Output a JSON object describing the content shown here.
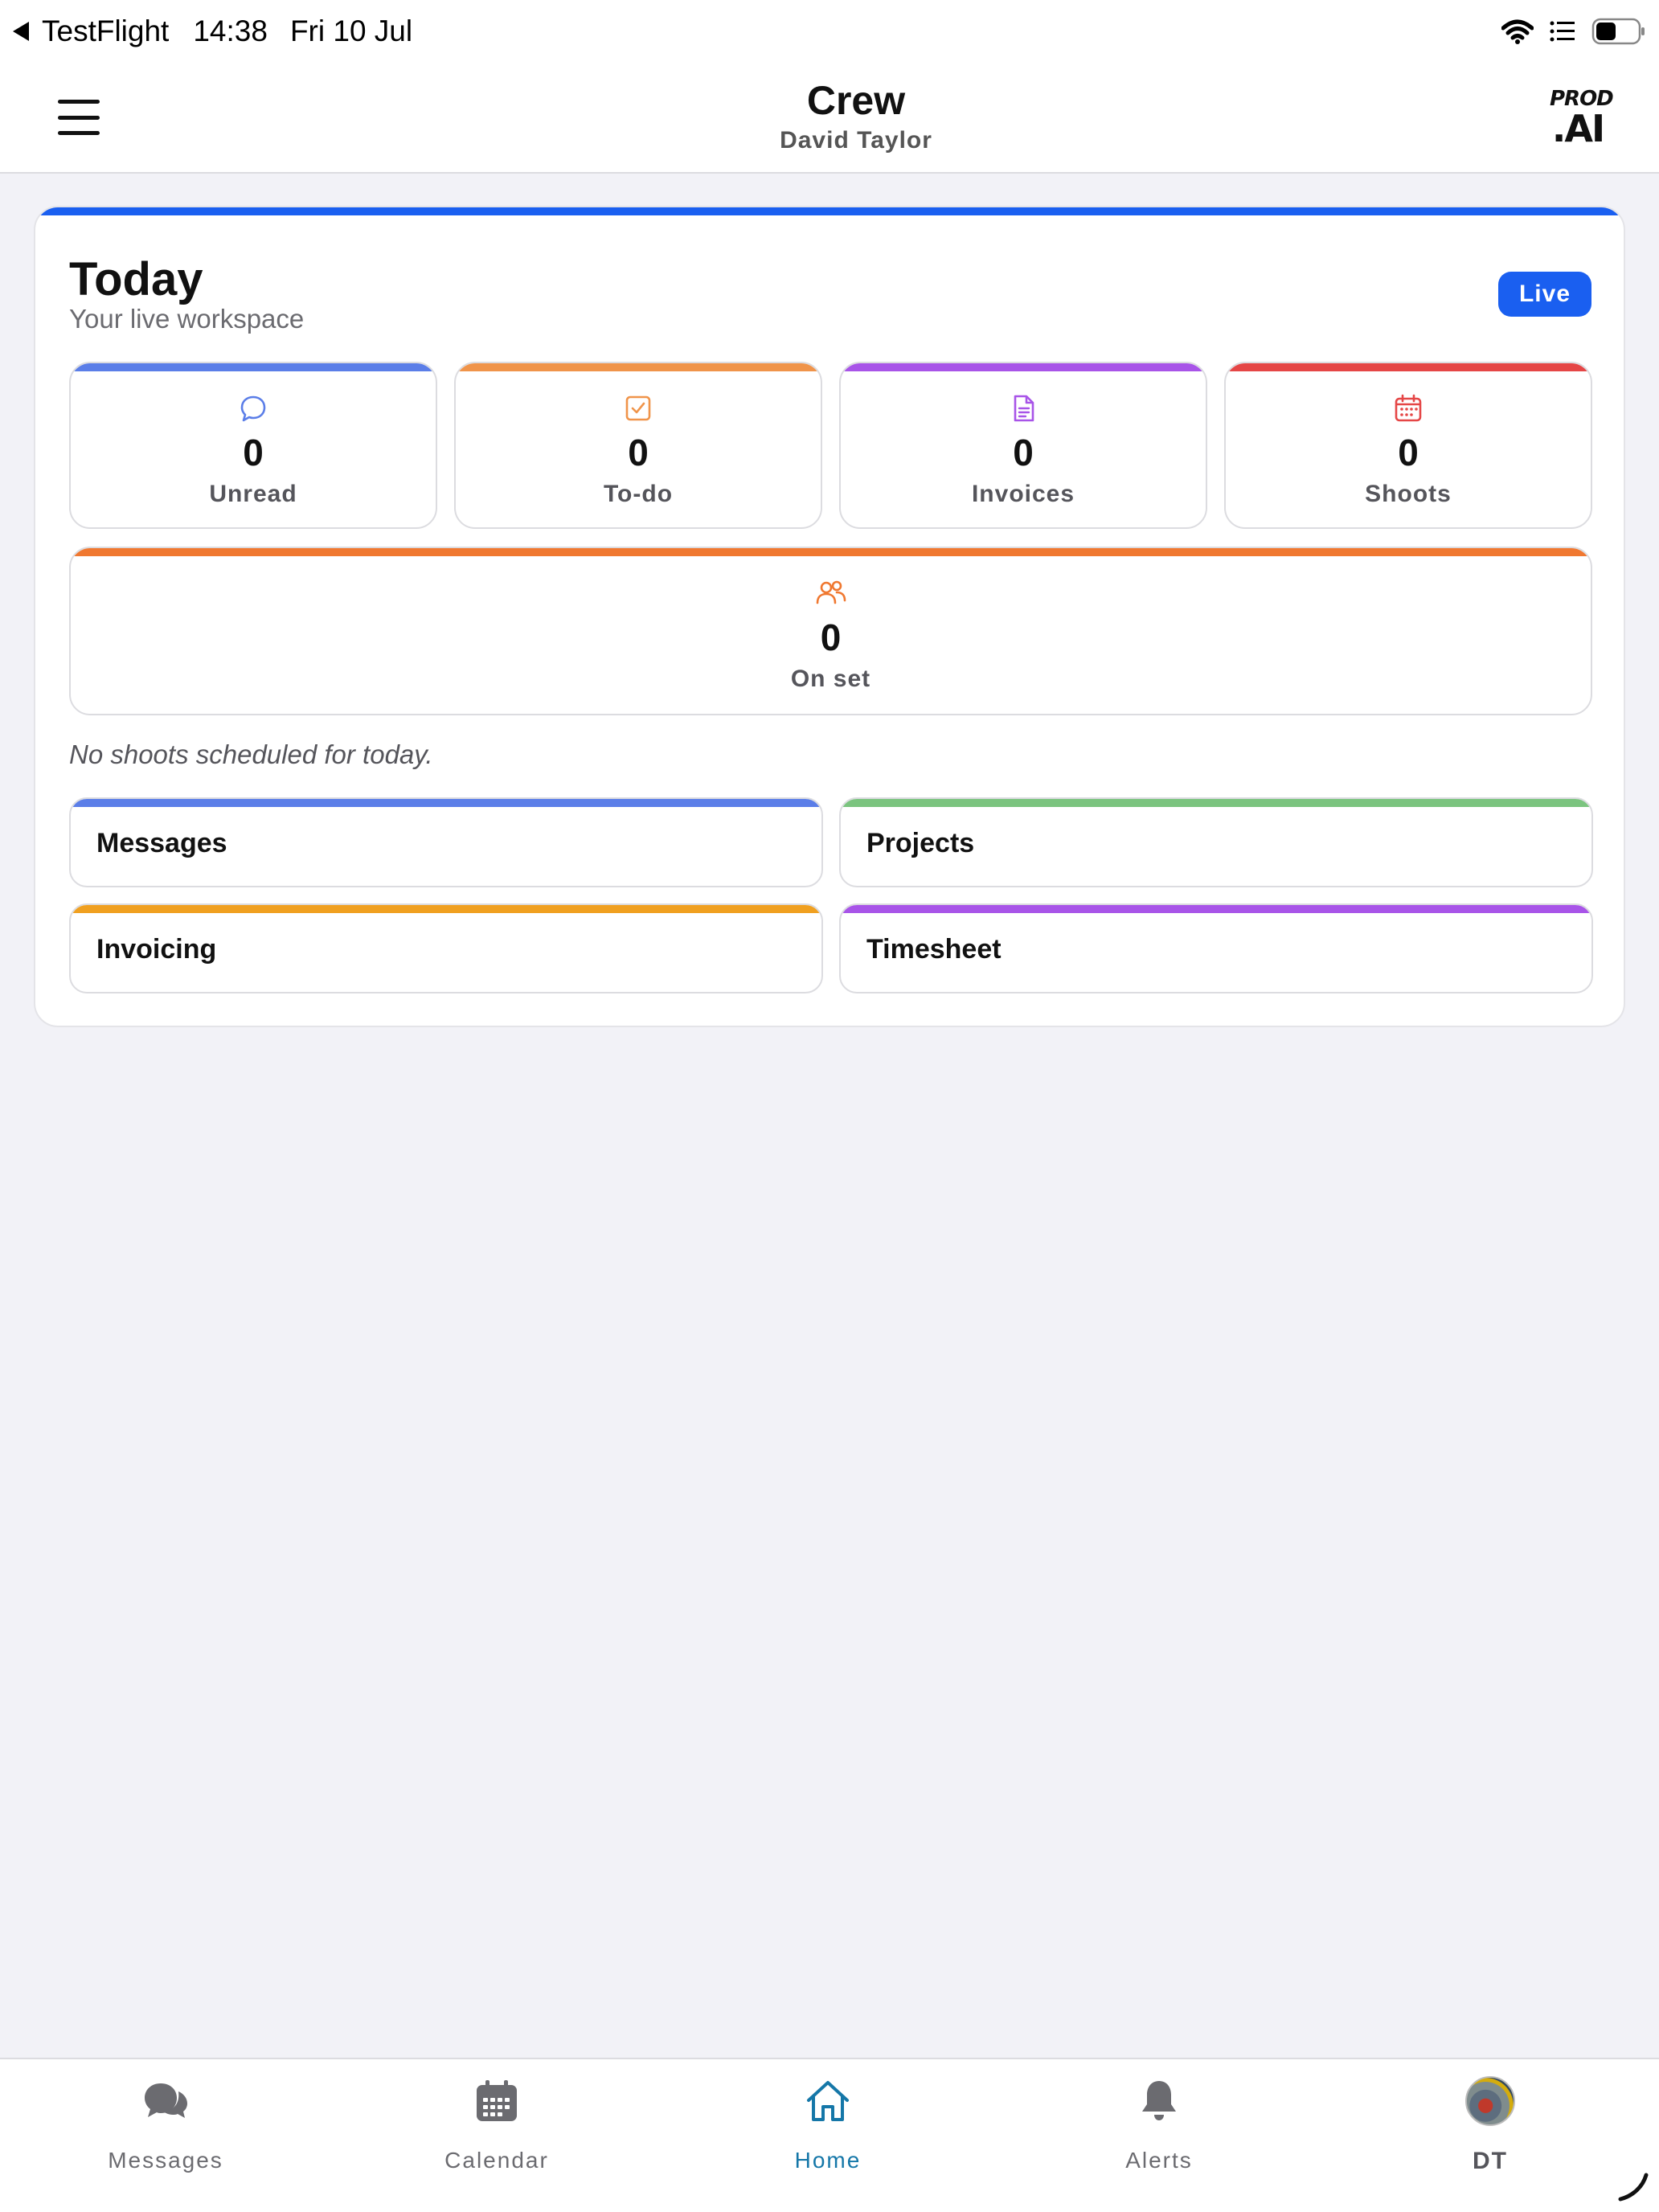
{
  "status_bar": {
    "back_app": "TestFlight",
    "time": "14:38",
    "date": "Fri 10 Jul"
  },
  "header": {
    "title": "Crew",
    "subtitle": "David Taylor",
    "logo_top": "PROD",
    "logo_bottom": ".AI"
  },
  "today": {
    "title": "Today",
    "subtitle": "Your live workspace",
    "badge": "Live",
    "accent_color": "#1a5ff0",
    "stats": [
      {
        "label": "Unread",
        "value": "0",
        "icon": "chat-bubble-icon",
        "color": "#5b7ee8"
      },
      {
        "label": "To-do",
        "value": "0",
        "icon": "checkbox-icon",
        "color": "#f0944a"
      },
      {
        "label": "Invoices",
        "value": "0",
        "icon": "document-icon",
        "color": "#a854e8"
      },
      {
        "label": "Shoots",
        "value": "0",
        "icon": "calendar-icon",
        "color": "#e54646"
      }
    ],
    "on_set": {
      "label": "On set",
      "value": "0",
      "icon": "people-icon",
      "color": "#f07830"
    },
    "empty_note": "No shoots scheduled for today.",
    "links": [
      {
        "label": "Messages",
        "color": "#5b7ee8"
      },
      {
        "label": "Projects",
        "color": "#7bc47f"
      },
      {
        "label": "Invoicing",
        "color": "#f0a020"
      },
      {
        "label": "Timesheet",
        "color": "#a854e8"
      }
    ]
  },
  "tab_bar": {
    "active": "Home",
    "active_color": "#1577a8",
    "tabs": [
      {
        "label": "Messages",
        "icon": "chat-bubbles-icon"
      },
      {
        "label": "Calendar",
        "icon": "calendar-icon"
      },
      {
        "label": "Home",
        "icon": "home-icon"
      },
      {
        "label": "Alerts",
        "icon": "bell-icon"
      },
      {
        "label": "DT",
        "icon": "avatar"
      }
    ]
  }
}
